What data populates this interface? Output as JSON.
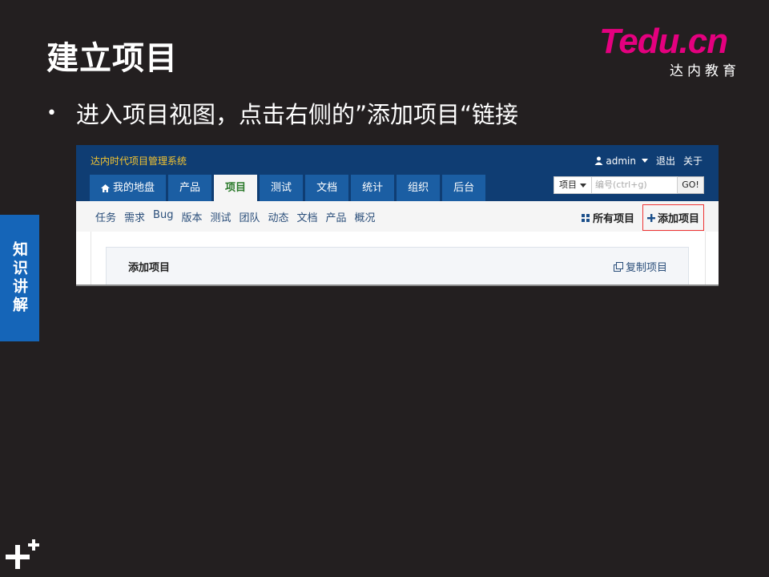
{
  "slide": {
    "title": "建立项目",
    "bullet": "进入项目视图，点击右侧的”添加项目“链接",
    "side_tab": "知识讲解",
    "logo": {
      "word_t": "T",
      "word_edu": "edu",
      "word_dot": ".",
      "word_cn": "cn",
      "subtitle": "达内教育"
    },
    "accent": "#1565b8",
    "brand": "#e4007f"
  },
  "app": {
    "name": "达内时代项目管理系统",
    "user": "admin",
    "logout": "退出",
    "about": "关于",
    "tabs": [
      {
        "label": "我的地盘",
        "icon": "home-icon"
      },
      {
        "label": "产品"
      },
      {
        "label": "项目",
        "active": true
      },
      {
        "label": "测试"
      },
      {
        "label": "文档"
      },
      {
        "label": "统计"
      },
      {
        "label": "组织"
      },
      {
        "label": "后台"
      }
    ],
    "search": {
      "scope": "项目",
      "placeholder": "编号(ctrl+g)",
      "go": "GO!"
    },
    "subnav": [
      "任务",
      "需求",
      "Bug",
      "版本",
      "测试",
      "团队",
      "动态",
      "文档",
      "产品",
      "概况"
    ],
    "all_projects": "所有项目",
    "add_project": "添加项目",
    "panel_title": "添加项目",
    "copy_project": "复制项目"
  }
}
